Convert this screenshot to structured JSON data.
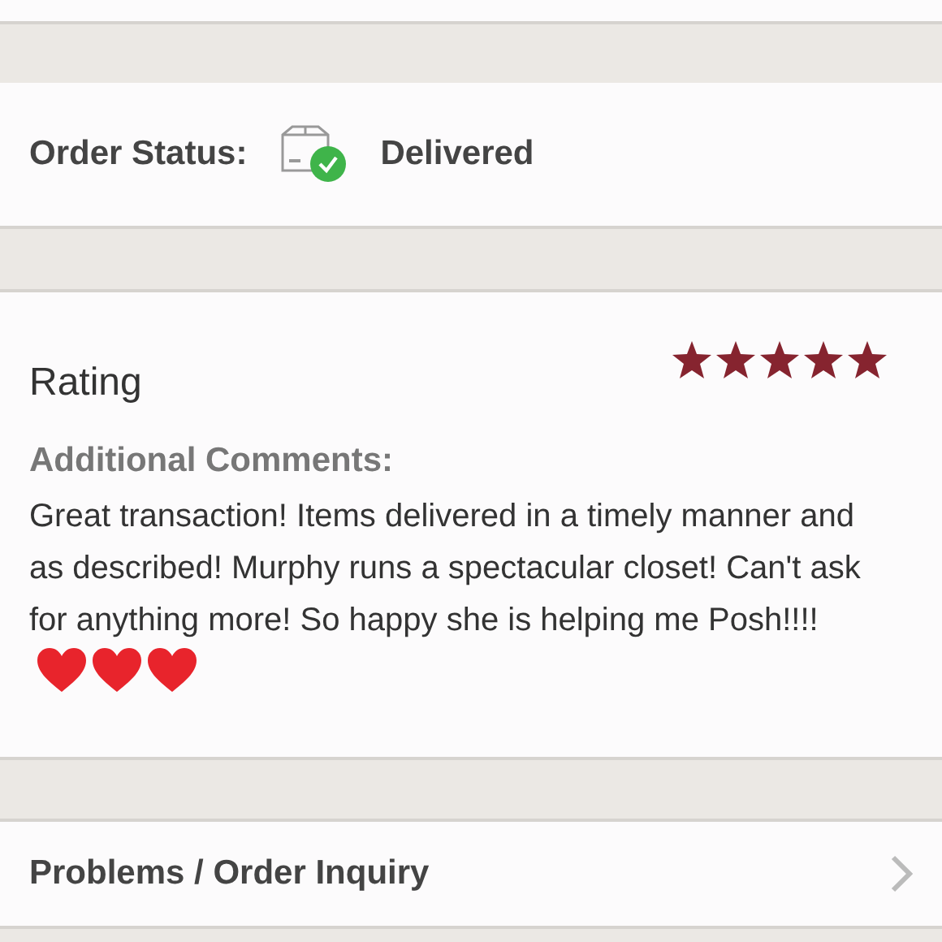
{
  "order_status": {
    "label": "Order Status:",
    "status": "Delivered"
  },
  "rating": {
    "title": "Rating",
    "stars": 5,
    "comments_label": "Additional Comments:",
    "comments": "Great transaction! Items delivered in a timely manner and as described! Murphy runs a spectacular closet! Can't ask for anything more! So happy she is helping me Posh!!!!",
    "emojis": [
      {
        "kind": "heart"
      },
      {
        "kind": "heart"
      },
      {
        "kind": "heart"
      }
    ]
  },
  "menu_item": {
    "label": "Problems / Order Inquiry"
  }
}
